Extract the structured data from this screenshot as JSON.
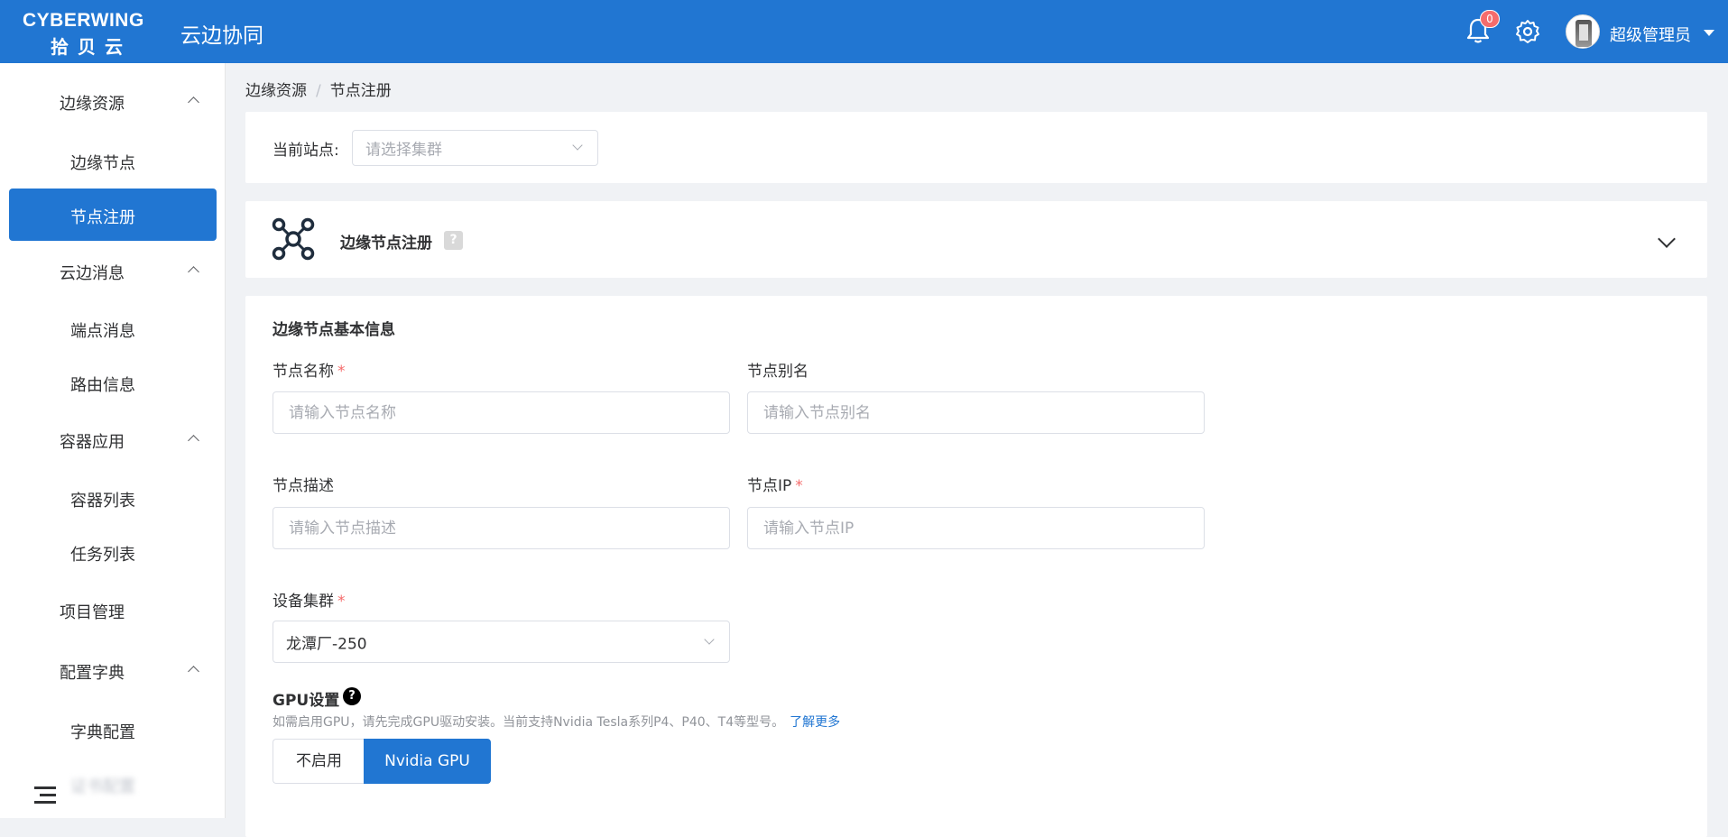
{
  "header": {
    "logo_line1": "CYBERWING",
    "logo_line2": "拾贝云",
    "title": "云边协同",
    "notification_count": "0",
    "user_name": "超级管理员"
  },
  "sidebar": {
    "groups": [
      {
        "label": "边缘资源",
        "items": [
          "边缘节点",
          "节点注册"
        ]
      },
      {
        "label": "云边消息",
        "items": [
          "端点消息",
          "路由信息"
        ]
      },
      {
        "label": "容器应用",
        "items": [
          "容器列表",
          "任务列表"
        ]
      },
      {
        "label": "项目管理"
      },
      {
        "label": "配置字典",
        "items": [
          "字典配置",
          "证书配置"
        ]
      }
    ],
    "active_item": "节点注册"
  },
  "breadcrumb": [
    "边缘资源",
    "节点注册"
  ],
  "site": {
    "label": "当前站点:",
    "placeholder": "请选择集群"
  },
  "registration": {
    "title": "边缘节点注册",
    "help": "?"
  },
  "form": {
    "section_title": "边缘节点基本信息",
    "node_name": {
      "label": "节点名称",
      "required": "*",
      "placeholder": "请输入节点名称"
    },
    "node_alias": {
      "label": "节点别名",
      "placeholder": "请输入节点别名"
    },
    "node_desc": {
      "label": "节点描述",
      "placeholder": "请输入节点描述"
    },
    "node_ip": {
      "label": "节点IP",
      "required": "*",
      "placeholder": "请输入节点IP"
    },
    "cluster": {
      "label": "设备集群",
      "required": "*",
      "value": "龙潭厂-250"
    },
    "gpu": {
      "title": "GPU设置",
      "help": "?",
      "note": "如需启用GPU，请先完成GPU驱动安装。当前支持Nvidia Tesla系列P4、P40、T4等型号。",
      "link": "了解更多",
      "options": [
        "不启用",
        "Nvidia GPU"
      ],
      "selected": "Nvidia GPU"
    }
  },
  "colors": {
    "primary": "#2176d2",
    "required": "#f56c6c",
    "background": "#f0f2f5"
  }
}
